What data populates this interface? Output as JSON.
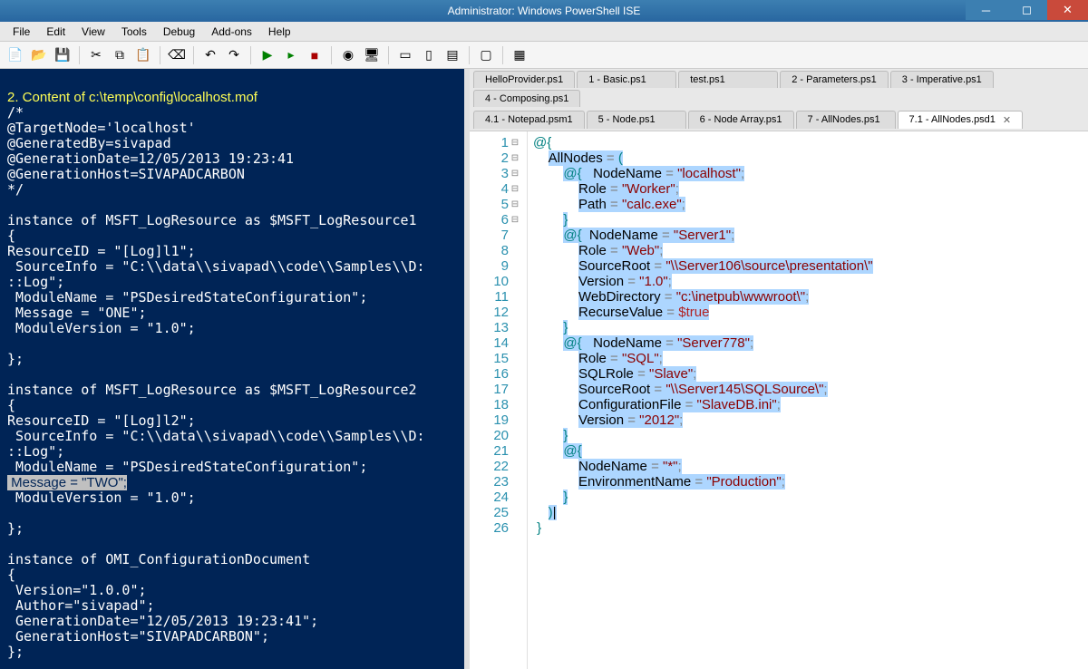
{
  "window": {
    "title": "Administrator: Windows PowerShell ISE"
  },
  "menu": {
    "items": [
      "File",
      "Edit",
      "View",
      "Tools",
      "Debug",
      "Add-ons",
      "Help"
    ]
  },
  "tabs_row1": [
    {
      "label": "HelloProvider.ps1"
    },
    {
      "label": "1 - Basic.ps1"
    },
    {
      "label": "test.ps1"
    },
    {
      "label": "2 - Parameters.ps1"
    },
    {
      "label": "3 - Imperative.ps1"
    },
    {
      "label": "4 - Composing.ps1"
    }
  ],
  "tabs_row2": [
    {
      "label": "4.1 - Notepad.psm1"
    },
    {
      "label": "5 - Node.ps1"
    },
    {
      "label": "6 - Node Array.ps1"
    },
    {
      "label": "7 - AllNodes.ps1"
    },
    {
      "label": "7.1 - AllNodes.psd1",
      "active": true,
      "close": true
    }
  ],
  "console": {
    "header": "2. Content of c:\\temp\\config\\localhost.mof",
    "lines": [
      "/*",
      "@TargetNode='localhost'",
      "@GeneratedBy=sivapad",
      "@GenerationDate=12/05/2013 19:23:41",
      "@GenerationHost=SIVAPADCARBON",
      "*/",
      "",
      "instance of MSFT_LogResource as $MSFT_LogResource1",
      "{",
      "ResourceID = \"[Log]l1\";",
      " SourceInfo = \"C:\\\\data\\\\sivapad\\\\code\\\\Samples\\\\D:",
      "::Log\";",
      " ModuleName = \"PSDesiredStateConfiguration\";",
      " Message = \"ONE\";",
      " ModuleVersion = \"1.0\";",
      "",
      "};",
      "",
      "instance of MSFT_LogResource as $MSFT_LogResource2",
      "{",
      "ResourceID = \"[Log]l2\";",
      " SourceInfo = \"C:\\\\data\\\\sivapad\\\\code\\\\Samples\\\\D:",
      "::Log\";",
      " ModuleName = \"PSDesiredStateConfiguration\";"
    ],
    "highlighted_line": " Message = \"TWO\";",
    "lines_after": [
      " ModuleVersion = \"1.0\";",
      "",
      "};",
      "",
      "instance of OMI_ConfigurationDocument",
      "{",
      " Version=\"1.0.0\";",
      " Author=\"sivapad\";",
      " GenerationDate=\"12/05/2013 19:23:41\";",
      " GenerationHost=\"SIVAPADCARBON\";",
      "};"
    ]
  },
  "editor": {
    "line_count": 26,
    "code": [
      {
        "n": 1,
        "fold": "-",
        "tokens": [
          {
            "t": "@{",
            "c": "k-teal"
          }
        ]
      },
      {
        "n": 2,
        "fold": "-",
        "sel": true,
        "indent": 4,
        "tokens": [
          {
            "t": "AllNodes",
            "c": ""
          },
          {
            "t": " = ",
            "c": "k-op"
          },
          {
            "t": "(",
            "c": "k-teal"
          }
        ]
      },
      {
        "n": 3,
        "fold": "-",
        "sel": true,
        "indent": 8,
        "tokens": [
          {
            "t": "@{",
            "c": "k-teal"
          },
          {
            "t": "   NodeName ",
            "c": ""
          },
          {
            "t": "=",
            "c": "k-op"
          },
          {
            "t": " \"localhost\"",
            "c": "k-str"
          },
          {
            "t": ";",
            "c": "k-op"
          }
        ]
      },
      {
        "n": 4,
        "sel": true,
        "indent": 12,
        "tokens": [
          {
            "t": "Role ",
            "c": ""
          },
          {
            "t": "=",
            "c": "k-op"
          },
          {
            "t": " \"Worker\"",
            "c": "k-str"
          },
          {
            "t": ";",
            "c": "k-op"
          }
        ]
      },
      {
        "n": 5,
        "sel": true,
        "indent": 12,
        "tokens": [
          {
            "t": "Path ",
            "c": ""
          },
          {
            "t": "=",
            "c": "k-op"
          },
          {
            "t": " \"calc.exe\"",
            "c": "k-str"
          },
          {
            "t": ";",
            "c": "k-op"
          }
        ]
      },
      {
        "n": 6,
        "sel": true,
        "indent": 8,
        "tokens": [
          {
            "t": "}",
            "c": "k-teal"
          }
        ]
      },
      {
        "n": 7,
        "fold": "-",
        "sel": true,
        "indent": 8,
        "tokens": [
          {
            "t": "@{",
            "c": "k-teal"
          },
          {
            "t": "  NodeName ",
            "c": ""
          },
          {
            "t": "=",
            "c": "k-op"
          },
          {
            "t": " \"Server1\"",
            "c": "k-str"
          },
          {
            "t": ";",
            "c": "k-op"
          }
        ]
      },
      {
        "n": 8,
        "sel": true,
        "indent": 12,
        "tokens": [
          {
            "t": "Role ",
            "c": ""
          },
          {
            "t": "=",
            "c": "k-op"
          },
          {
            "t": " \"Web\"",
            "c": "k-str"
          },
          {
            "t": ";",
            "c": "k-op"
          }
        ]
      },
      {
        "n": 9,
        "sel": true,
        "indent": 12,
        "tokens": [
          {
            "t": "SourceRoot ",
            "c": ""
          },
          {
            "t": "=",
            "c": "k-op"
          },
          {
            "t": " \"\\\\Server106\\source\\presentation\\\"",
            "c": "k-str"
          }
        ]
      },
      {
        "n": 10,
        "sel": true,
        "indent": 12,
        "tokens": [
          {
            "t": "Version ",
            "c": ""
          },
          {
            "t": "=",
            "c": "k-op"
          },
          {
            "t": " \"1.0\"",
            "c": "k-str"
          },
          {
            "t": ";",
            "c": "k-op"
          }
        ]
      },
      {
        "n": 11,
        "sel": true,
        "indent": 12,
        "tokens": [
          {
            "t": "WebDirectory ",
            "c": ""
          },
          {
            "t": "=",
            "c": "k-op"
          },
          {
            "t": " \"c:\\inetpub\\wwwroot\\\"",
            "c": "k-str"
          },
          {
            "t": ";",
            "c": "k-op"
          }
        ]
      },
      {
        "n": 12,
        "sel": true,
        "indent": 12,
        "tokens": [
          {
            "t": "RecurseValue ",
            "c": ""
          },
          {
            "t": "=",
            "c": "k-op"
          },
          {
            "t": " $true",
            "c": "k-var"
          }
        ]
      },
      {
        "n": 13,
        "sel": true,
        "indent": 8,
        "tokens": [
          {
            "t": "}",
            "c": "k-teal"
          }
        ]
      },
      {
        "n": 14,
        "fold": "-",
        "sel": true,
        "indent": 8,
        "tokens": [
          {
            "t": "@{",
            "c": "k-teal"
          },
          {
            "t": "   NodeName ",
            "c": ""
          },
          {
            "t": "=",
            "c": "k-op"
          },
          {
            "t": " \"Server778\"",
            "c": "k-str"
          },
          {
            "t": ";",
            "c": "k-op"
          }
        ]
      },
      {
        "n": 15,
        "sel": true,
        "indent": 12,
        "tokens": [
          {
            "t": "Role ",
            "c": ""
          },
          {
            "t": "=",
            "c": "k-op"
          },
          {
            "t": " \"SQL\"",
            "c": "k-str"
          },
          {
            "t": ";",
            "c": "k-op"
          }
        ]
      },
      {
        "n": 16,
        "sel": true,
        "indent": 12,
        "tokens": [
          {
            "t": "SQLRole ",
            "c": ""
          },
          {
            "t": "=",
            "c": "k-op"
          },
          {
            "t": " \"Slave\"",
            "c": "k-str"
          },
          {
            "t": ";",
            "c": "k-op"
          }
        ]
      },
      {
        "n": 17,
        "sel": true,
        "indent": 12,
        "tokens": [
          {
            "t": "SourceRoot ",
            "c": ""
          },
          {
            "t": "=",
            "c": "k-op"
          },
          {
            "t": " \"\\\\Server145\\SQLSource\\\"",
            "c": "k-str"
          },
          {
            "t": ";",
            "c": "k-op"
          }
        ]
      },
      {
        "n": 18,
        "sel": true,
        "indent": 12,
        "tokens": [
          {
            "t": "ConfigurationFile ",
            "c": ""
          },
          {
            "t": "=",
            "c": "k-op"
          },
          {
            "t": " \"SlaveDB.ini\"",
            "c": "k-str"
          },
          {
            "t": ";",
            "c": "k-op"
          }
        ]
      },
      {
        "n": 19,
        "sel": true,
        "indent": 12,
        "tokens": [
          {
            "t": "Version ",
            "c": ""
          },
          {
            "t": "=",
            "c": "k-op"
          },
          {
            "t": " \"2012\"",
            "c": "k-str"
          },
          {
            "t": ";",
            "c": "k-op"
          }
        ]
      },
      {
        "n": 20,
        "sel": true,
        "indent": 8,
        "tokens": [
          {
            "t": "}",
            "c": "k-teal"
          }
        ]
      },
      {
        "n": 21,
        "fold": "-",
        "sel": true,
        "indent": 8,
        "tokens": [
          {
            "t": "@{",
            "c": "k-teal"
          }
        ]
      },
      {
        "n": 22,
        "sel": true,
        "indent": 12,
        "tokens": [
          {
            "t": "NodeName ",
            "c": ""
          },
          {
            "t": "=",
            "c": "k-op"
          },
          {
            "t": " \"*\"",
            "c": "k-str"
          },
          {
            "t": ";",
            "c": "k-op"
          }
        ]
      },
      {
        "n": 23,
        "sel": true,
        "indent": 12,
        "tokens": [
          {
            "t": "EnvironmentName ",
            "c": ""
          },
          {
            "t": "=",
            "c": "k-op"
          },
          {
            "t": " \"Production\"",
            "c": "k-str"
          },
          {
            "t": ";",
            "c": "k-op"
          }
        ]
      },
      {
        "n": 24,
        "sel": true,
        "indent": 8,
        "tokens": [
          {
            "t": "}",
            "c": "k-teal"
          }
        ]
      },
      {
        "n": 25,
        "sel": true,
        "indent": 4,
        "tokens": [
          {
            "t": ")",
            "c": "k-teal"
          },
          {
            "t": "|",
            "c": ""
          }
        ]
      },
      {
        "n": 26,
        "indent": 1,
        "tokens": [
          {
            "t": "}",
            "c": "k-teal"
          }
        ]
      }
    ]
  }
}
